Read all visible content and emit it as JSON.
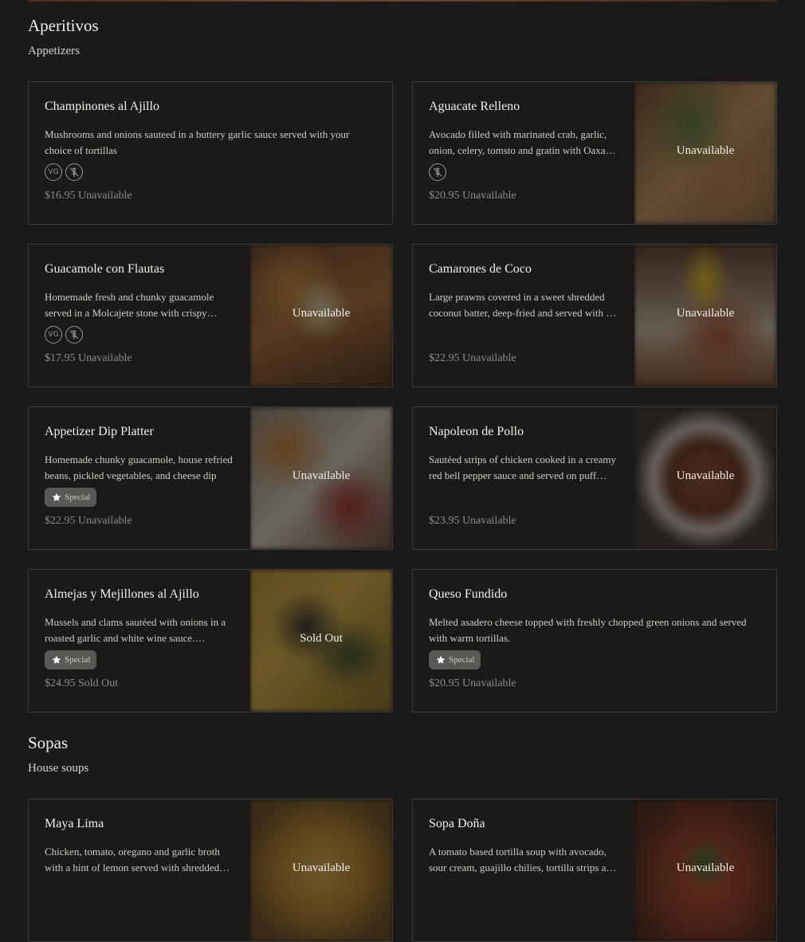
{
  "sections": [
    {
      "title": "Aperitivos",
      "subtitle": "Appetizers",
      "items": [
        {
          "name": "Champinones al Ajillo",
          "description": "Mushrooms and onions sauteed in a buttery garlic sauce served with your choice of tortillas",
          "price": "$16.95 Unavailable",
          "tags": [
            "vegetarian-icon",
            "gluten-free-icon"
          ]
        },
        {
          "name": "Aguacate Relleno",
          "description": "Avocado filled with marinated crab, garlic, onion, celery, tomsto and gratin with Oaxaca cheese",
          "price": "$20.95 Unavailable",
          "tags": [
            "gluten-free-icon"
          ],
          "image_status": "Unavailable"
        },
        {
          "name": "Guacamole con Flautas",
          "description": "Homemade fresh and chunky guacamole served in a Molcajete stone with crispy rolled flautas",
          "price": "$17.95 Unavailable",
          "tags": [
            "vegetarian-icon",
            "gluten-free-icon"
          ],
          "image_status": "Unavailable"
        },
        {
          "name": "Camarones de Coco",
          "description": "Large prawns covered in a sweet shredded coconut batter, deep-fried and served with a mango sauce",
          "price": "$22.95 Unavailable",
          "tags": [],
          "image_status": "Unavailable"
        },
        {
          "name": "Appetizer Dip Platter",
          "description": "Homemade chunky guacamole, house refried beans, pickled vegetables, and cheese dip",
          "price": "$22.95 Unavailable",
          "special": "Special",
          "image_status": "Unavailable"
        },
        {
          "name": "Napoleon de Pollo",
          "description": "Sautéed strips of chicken cooked in a creamy red bell pepper sauce and served on puff pastry",
          "price": "$23.95 Unavailable",
          "tags": [],
          "image_status": "Unavailable"
        },
        {
          "name": "Almejas y Mejillones al Ajillo",
          "description": "Mussels and clams sautéed with onions in a roasted garlic and white wine sauce. Finished with cilantro",
          "price": "$24.95 Sold Out",
          "special": "Special",
          "image_status": "Sold Out"
        },
        {
          "name": "Queso Fundido",
          "description": "Melted asadero cheese topped with freshly chopped green onions and served with warm tortillas.",
          "price": "$20.95 Unavailable",
          "special": "Special"
        }
      ]
    },
    {
      "title": "Sopas",
      "subtitle": "House soups",
      "items": [
        {
          "name": "Maya Lima",
          "description": "Chicken, tomato, oregano and garlic broth with a hint of lemon served with shredded chicken",
          "image_status": "Unavailable"
        },
        {
          "name": "Sopa Doña",
          "description": "A tomato based tortilla soup with avocado, sour cream, guajillo chilies, tortilla strips and cheese",
          "image_status": "Unavailable"
        }
      ]
    }
  ],
  "icons": {
    "vegetarian": "VG",
    "special": "star-icon"
  },
  "colors": {
    "background": "#1b1a19",
    "border": "#3b3a38",
    "special_badge": "#5a5855",
    "price": "#8f8b86"
  }
}
